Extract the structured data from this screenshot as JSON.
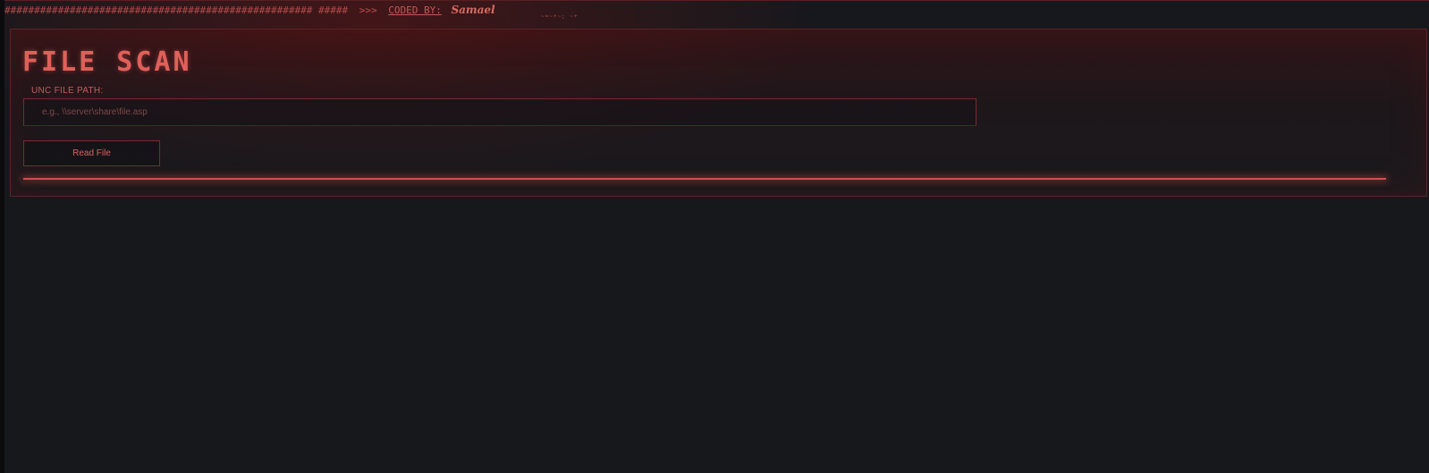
{
  "banner": {
    "hashes": "####################################################",
    "hashes_short": "#####",
    "arrow": ">>>",
    "coded_by": "CODED BY:",
    "author": "Samael",
    "sub_text": "~=~+~;  ~+"
  },
  "panel": {
    "title": "FILE SCAN",
    "field_label": "UNC FILE PATH:",
    "input_value": "",
    "input_placeholder": "e.g., \\\\server\\share\\file.asp",
    "button_label": "Read File"
  },
  "progress": {
    "value": 1.0
  },
  "colors": {
    "accent": "#e0605a",
    "background": "#17181c",
    "border": "#5a2427"
  }
}
